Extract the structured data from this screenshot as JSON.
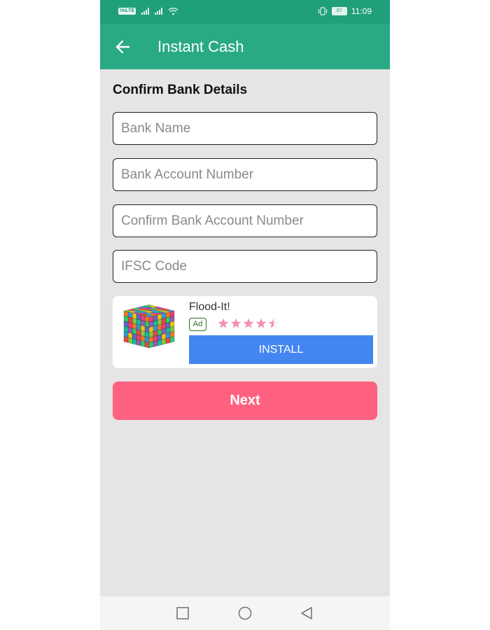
{
  "status_bar": {
    "network_badge": "VoLTE",
    "battery": "87",
    "time": "11:09"
  },
  "app_bar": {
    "back_icon": "arrow-left-icon",
    "title": "Instant Cash"
  },
  "form": {
    "heading": "Confirm Bank Details",
    "fields": [
      {
        "placeholder": "Bank Name",
        "value": ""
      },
      {
        "placeholder": "Bank Account Number",
        "value": ""
      },
      {
        "placeholder": "Confirm Bank Account Number",
        "value": ""
      },
      {
        "placeholder": "IFSC Code",
        "value": ""
      }
    ]
  },
  "ad": {
    "app_name": "Flood-It!",
    "badge": "Ad",
    "rating_stars": 4.5,
    "rating_max": 5,
    "install_label": "INSTALL",
    "install_color": "#4486f1",
    "star_color": "#f48fb1"
  },
  "next_button": {
    "label": "Next",
    "color": "#ff6281"
  },
  "nav_bar": {
    "icons": [
      "square-recents-icon",
      "circle-home-icon",
      "triangle-back-icon"
    ]
  },
  "colors": {
    "status_bar": "#1f9f7a",
    "app_bar": "#2aaa84",
    "background": "#e5e5e5"
  }
}
